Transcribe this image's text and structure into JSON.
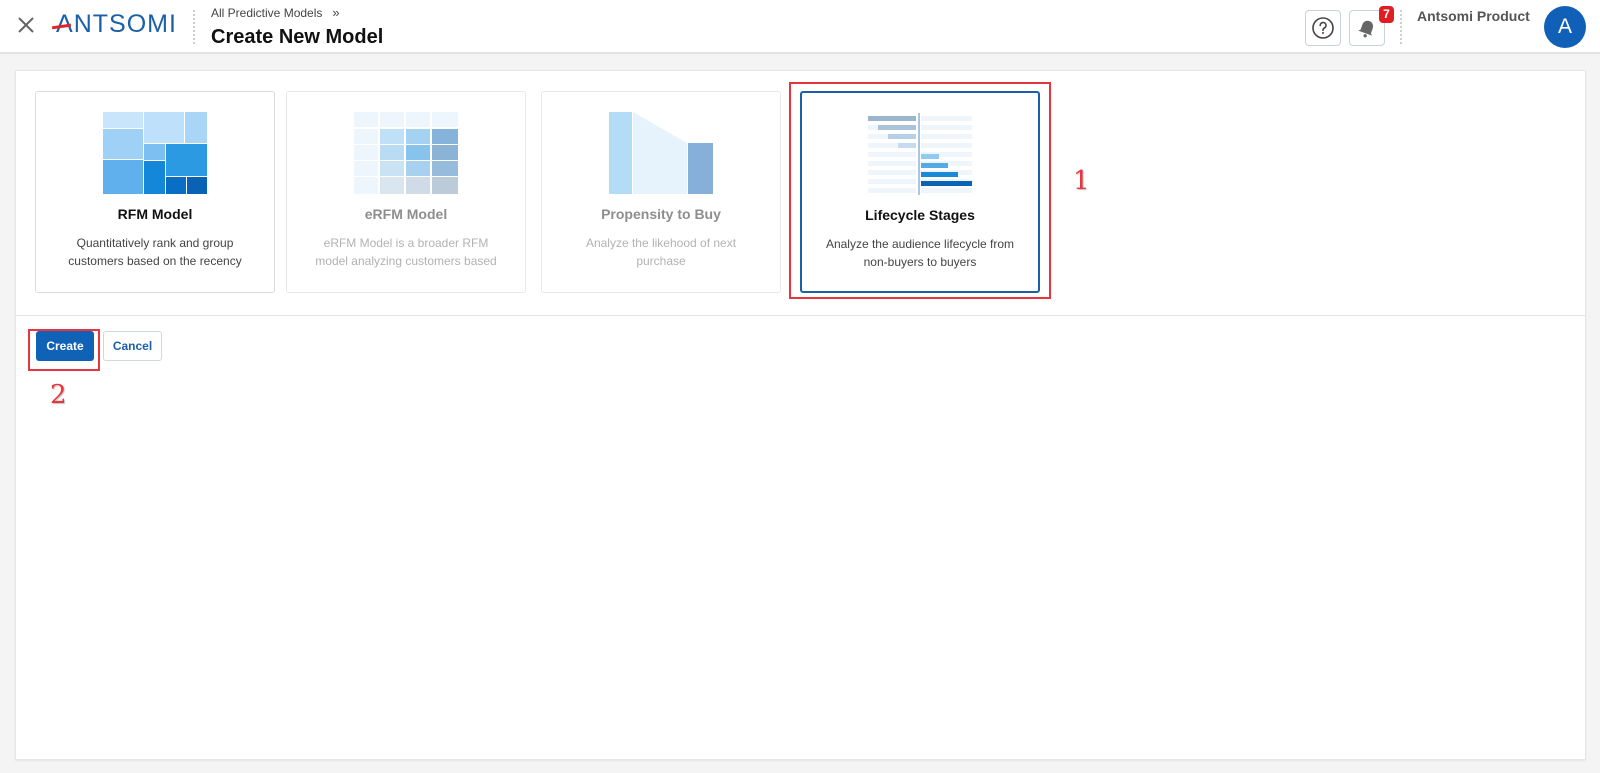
{
  "header": {
    "close_label": "close",
    "logo_text_a": "A",
    "logo_text_rest": "NTSOMI",
    "breadcrumb_parent": "All Predictive Models",
    "breadcrumb_sep": "»",
    "page_title": "Create New Model",
    "notification_count": "7",
    "user_name": "Antsomi Product",
    "avatar_initial": "A"
  },
  "cards": [
    {
      "title": "RFM Model",
      "description": "Quantitatively rank and group customers based on the recency",
      "state": "enabled",
      "icon": "rfm-treemap-icon"
    },
    {
      "title": "eRFM Model",
      "description": "eRFM Model is a broader RFM model analyzing customers based on their",
      "state": "disabled",
      "icon": "erfm-grid-icon"
    },
    {
      "title": "Propensity to Buy",
      "description": "Analyze the likehood of next purchase",
      "state": "disabled",
      "icon": "propensity-funnel-icon"
    },
    {
      "title": "Lifecycle Stages",
      "description": "Analyze the audience lifecycle from non-buyers to buyers",
      "state": "selected",
      "icon": "lifecycle-bars-icon"
    }
  ],
  "actions": {
    "create_label": "Create",
    "cancel_label": "Cancel"
  },
  "annotations": {
    "step1": "1",
    "step2": "2"
  },
  "colors": {
    "primary": "#1062b6",
    "annotation": "#e8343c",
    "badge": "#e11d24"
  }
}
